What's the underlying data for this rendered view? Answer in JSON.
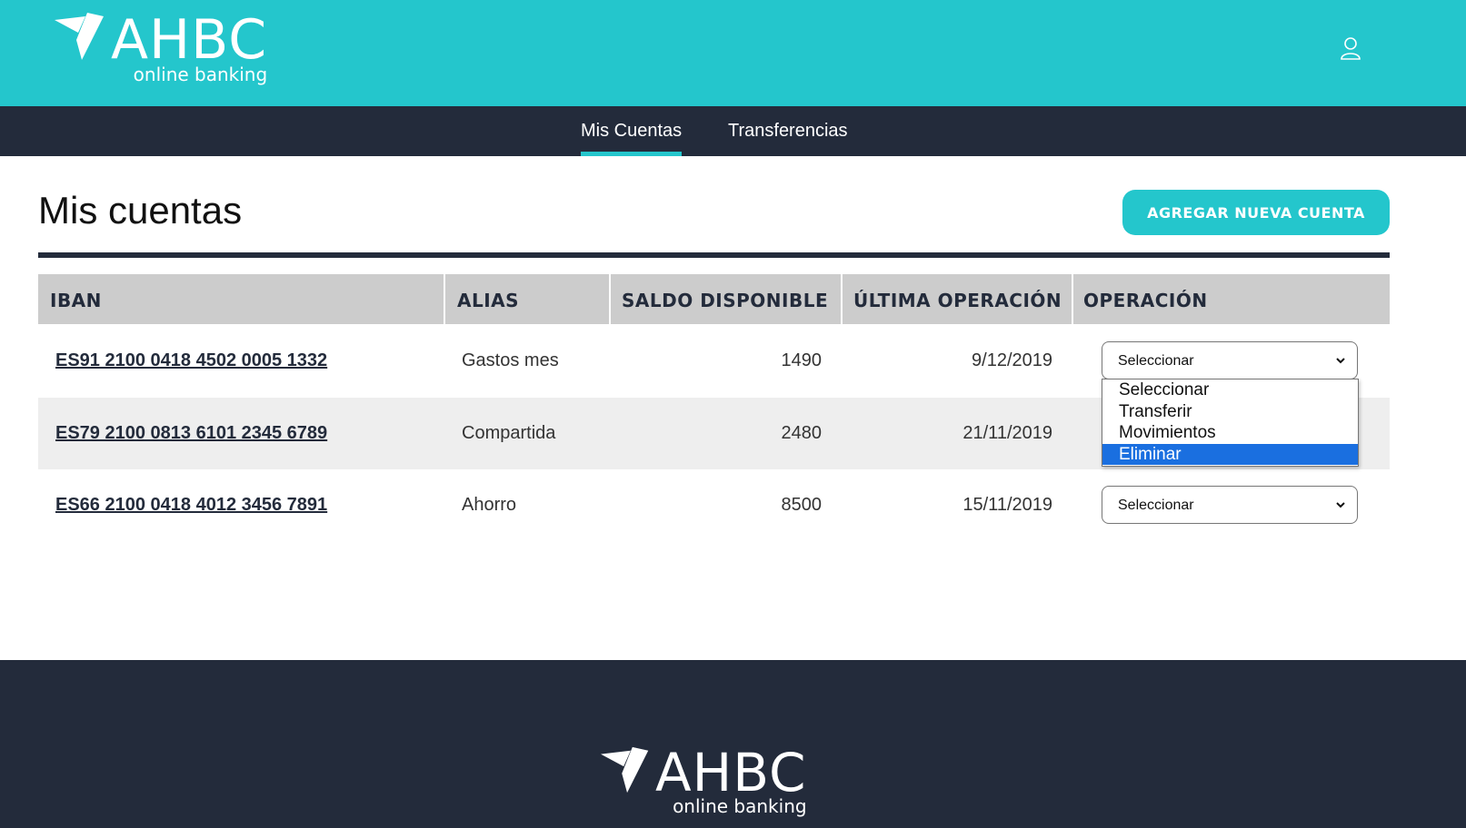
{
  "brand": {
    "name": "AHBC",
    "tagline": "online banking"
  },
  "header": {
    "user_icon": "user-icon"
  },
  "nav": {
    "items": [
      {
        "label": "Mis Cuentas",
        "active": true
      },
      {
        "label": "Transferencias",
        "active": false
      }
    ]
  },
  "main": {
    "title": "Mis cuentas",
    "add_button": "AGREGAR NUEVA CUENTA",
    "table": {
      "headers": [
        "IBAN",
        "ALIAS",
        "SALDO DISPONIBLE",
        "ÚLTIMA OPERACIÓN",
        "OPERACIÓN"
      ],
      "rows": [
        {
          "iban": "ES91 2100 0418 4502 0005 1332",
          "alias": "Gastos mes",
          "saldo": "1490",
          "fecha": "9/12/2019",
          "operacion": "Seleccionar"
        },
        {
          "iban": "ES79 2100 0813 6101 2345 6789",
          "alias": "Compartida",
          "saldo": "2480",
          "fecha": "21/11/2019",
          "operacion": "Seleccionar"
        },
        {
          "iban": "ES66 2100 0418 4012 3456 7891",
          "alias": "Ahorro",
          "saldo": "8500",
          "fecha": "15/11/2019",
          "operacion": "Seleccionar"
        }
      ]
    },
    "dropdown_open": {
      "options": [
        "Seleccionar",
        "Transferir",
        "Movimientos",
        "Eliminar"
      ],
      "highlighted": "Eliminar"
    }
  },
  "colors": {
    "accent": "#24c6cc",
    "dark": "#232b3b",
    "header_row": "#cccccc",
    "alt_row": "#eeeeee",
    "highlight": "#1a6fe0"
  }
}
